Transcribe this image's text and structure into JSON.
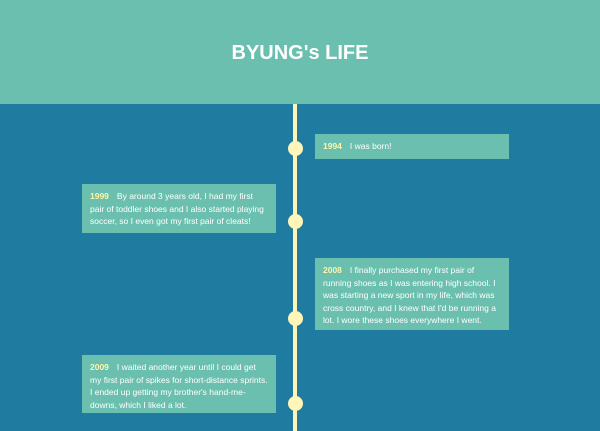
{
  "header": {
    "title": "BYUNG's LIFE"
  },
  "colors": {
    "background": "#207ba0",
    "card": "#6bbfae",
    "accent": "#fff5b8"
  },
  "timeline": [
    {
      "year": "1994",
      "text": "I was born!"
    },
    {
      "year": "1999",
      "text": "By around 3 years old, I had my first pair of toddler shoes and I also started playing soccer, so I even got my first pair of cleats!"
    },
    {
      "year": "2008",
      "text": "I finally purchased my first pair of running shoes as I was entering high school. I was starting a new sport in my life, which was cross country, and I knew that I'd be running a lot. I wore these shoes everywhere I went."
    },
    {
      "year": "2009",
      "text": "I waited another year until I could get my first pair of spikes for short-distance sprints. I ended up getting my brother's hand-me-downs, which I liked a lot."
    }
  ]
}
